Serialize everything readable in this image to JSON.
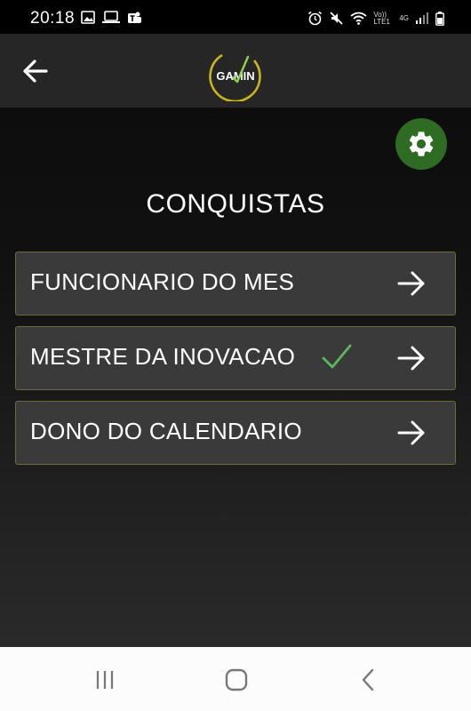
{
  "status_bar": {
    "time": "20:18",
    "volte_label": "Vo)) LTE1",
    "network_label": "4G"
  },
  "header": {
    "logo_text": "GAMIN"
  },
  "page": {
    "title": "CONQUISTAS"
  },
  "achievements": [
    {
      "label": "FUNCIONARIO DO MES",
      "completed": false
    },
    {
      "label": "MESTRE DA INOVACAO",
      "completed": true
    },
    {
      "label": "DONO DO CALENDARIO",
      "completed": false
    }
  ],
  "colors": {
    "settings_button": "#2e6b23",
    "check": "#5cb85c",
    "logo_accent": "#c8b51e"
  },
  "icons": {
    "back": "arrow-left-icon",
    "settings": "gear-icon",
    "row_arrow": "arrow-right-icon",
    "completed": "check-icon",
    "nav_recents": "recents-icon",
    "nav_home": "home-icon",
    "nav_back": "chevron-left-icon"
  }
}
